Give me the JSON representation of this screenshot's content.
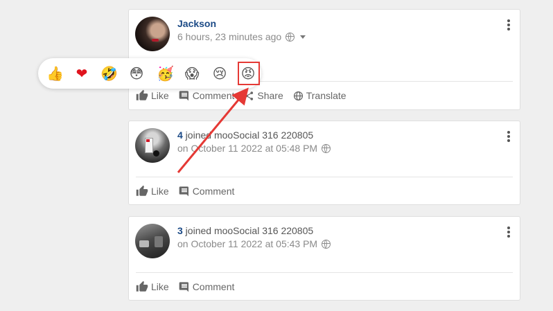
{
  "post1": {
    "author": "Jackson",
    "time": "6 hours, 23 minutes ago",
    "actions": {
      "like": "Like",
      "comment": "Comment",
      "share": "Share",
      "translate": "Translate"
    }
  },
  "post2": {
    "count": "4",
    "text": " joined mooSocial 316 220805",
    "time": "on October 11 2022 at 05:48 PM",
    "actions": {
      "like": "Like",
      "comment": "Comment"
    }
  },
  "post3": {
    "count": "3",
    "text": " joined mooSocial 316 220805",
    "time": "on October 11 2022 at 05:43 PM",
    "actions": {
      "like": "Like",
      "comment": "Comment"
    }
  },
  "reactions": [
    {
      "name": "like-reaction",
      "glyph": "👍"
    },
    {
      "name": "love-reaction",
      "glyph": "❤"
    },
    {
      "name": "haha-reaction",
      "glyph": "🤣"
    },
    {
      "name": "wow-reaction",
      "glyph": "😳"
    },
    {
      "name": "party-reaction",
      "glyph": "🥳"
    },
    {
      "name": "scared-reaction",
      "glyph": "😱"
    },
    {
      "name": "sad-reaction",
      "glyph": "😢"
    },
    {
      "name": "angry-reaction",
      "glyph": "😡"
    }
  ],
  "colors": {
    "link": "#1b4a86",
    "highlight": "#e53935",
    "background": "#efefef"
  }
}
